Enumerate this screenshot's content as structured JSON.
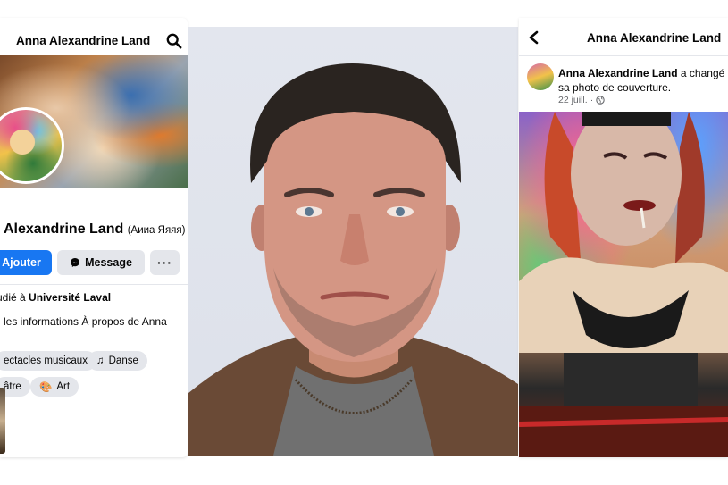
{
  "left_panel": {
    "header_title": "Anna Alexandrine Land",
    "profile_name": "Alexandrine Land",
    "alternate_name": "(Аииа Яяяя)",
    "add_button": "Ajouter",
    "message_button": "Message",
    "more_button": "···",
    "studied_prefix": "udié à",
    "studied_school": "Université Laval",
    "about_text": "les informations À propos de Anna",
    "interests": [
      {
        "label": "ectacles musicaux",
        "icon": ""
      },
      {
        "label": "Danse",
        "icon": "music-note-icon"
      },
      {
        "label": "âtre",
        "icon": ""
      },
      {
        "label": "Art",
        "icon": "palette-icon"
      }
    ]
  },
  "right_panel": {
    "header_title": "Anna Alexandrine Land",
    "post_author": "Anna Alexandrine Land",
    "post_action": "a changé sa photo de couverture.",
    "post_date": "22 juill.",
    "post_privacy_icon": "globe-icon"
  },
  "colors": {
    "facebook_blue": "#1877f2",
    "button_gray": "#e4e6eb",
    "meta_gray": "#65676b"
  }
}
